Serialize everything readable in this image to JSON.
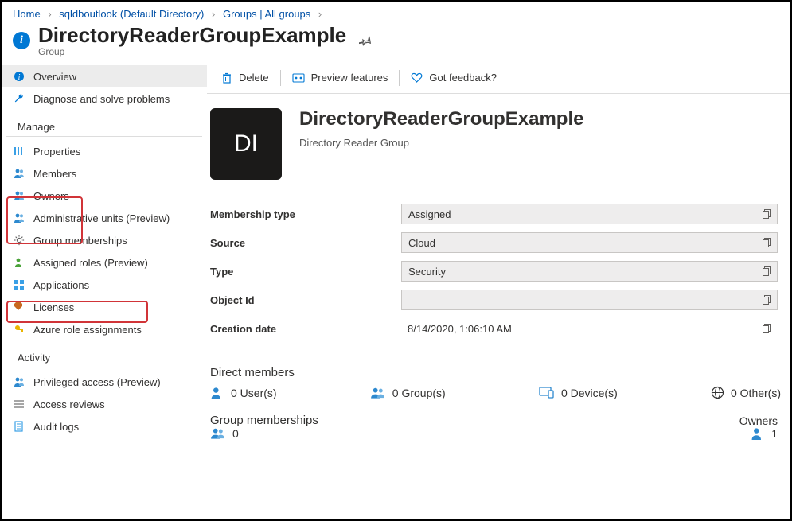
{
  "breadcrumb": {
    "items": [
      {
        "label": "Home"
      },
      {
        "label": "sqldboutlook (Default Directory)"
      },
      {
        "label": "Groups | All groups"
      }
    ]
  },
  "header": {
    "title": "DirectoryReaderGroupExample",
    "subtitle": "Group"
  },
  "sidebar": {
    "items": [
      {
        "label": "Overview",
        "icon": "info"
      },
      {
        "label": "Diagnose and solve problems",
        "icon": "wrench"
      }
    ],
    "manage_heading": "Manage",
    "manage_items": [
      {
        "label": "Properties",
        "icon": "props"
      },
      {
        "label": "Members",
        "icon": "people-blue"
      },
      {
        "label": "Owners",
        "icon": "people-blue"
      },
      {
        "label": "Administrative units (Preview)",
        "icon": "people-blue"
      },
      {
        "label": "Group memberships",
        "icon": "gear"
      },
      {
        "label": "Assigned roles (Preview)",
        "icon": "person-green"
      },
      {
        "label": "Applications",
        "icon": "apps"
      },
      {
        "label": "Licenses",
        "icon": "license"
      },
      {
        "label": "Azure role assignments",
        "icon": "key"
      }
    ],
    "activity_heading": "Activity",
    "activity_items": [
      {
        "label": "Privileged access (Preview)",
        "icon": "people-blue"
      },
      {
        "label": "Access reviews",
        "icon": "list"
      },
      {
        "label": "Audit logs",
        "icon": "log"
      }
    ]
  },
  "toolbar": {
    "delete": "Delete",
    "preview": "Preview features",
    "feedback": "Got feedback?"
  },
  "entity": {
    "initials": "DI",
    "name": "DirectoryReaderGroupExample",
    "desc": "Directory Reader Group"
  },
  "props": {
    "membership_type_label": "Membership type",
    "membership_type": "Assigned",
    "source_label": "Source",
    "source": "Cloud",
    "type_label": "Type",
    "type": "Security",
    "object_id_label": "Object Id",
    "object_id": "",
    "creation_label": "Creation date",
    "creation": "8/14/2020, 1:06:10 AM"
  },
  "direct_members": {
    "heading": "Direct members",
    "users": "0 User(s)",
    "groups": "0 Group(s)",
    "devices": "0 Device(s)",
    "others": "0 Other(s)"
  },
  "group_memberships": {
    "heading": "Group memberships",
    "count": "0",
    "owners_heading": "Owners",
    "owners_count": "1"
  }
}
